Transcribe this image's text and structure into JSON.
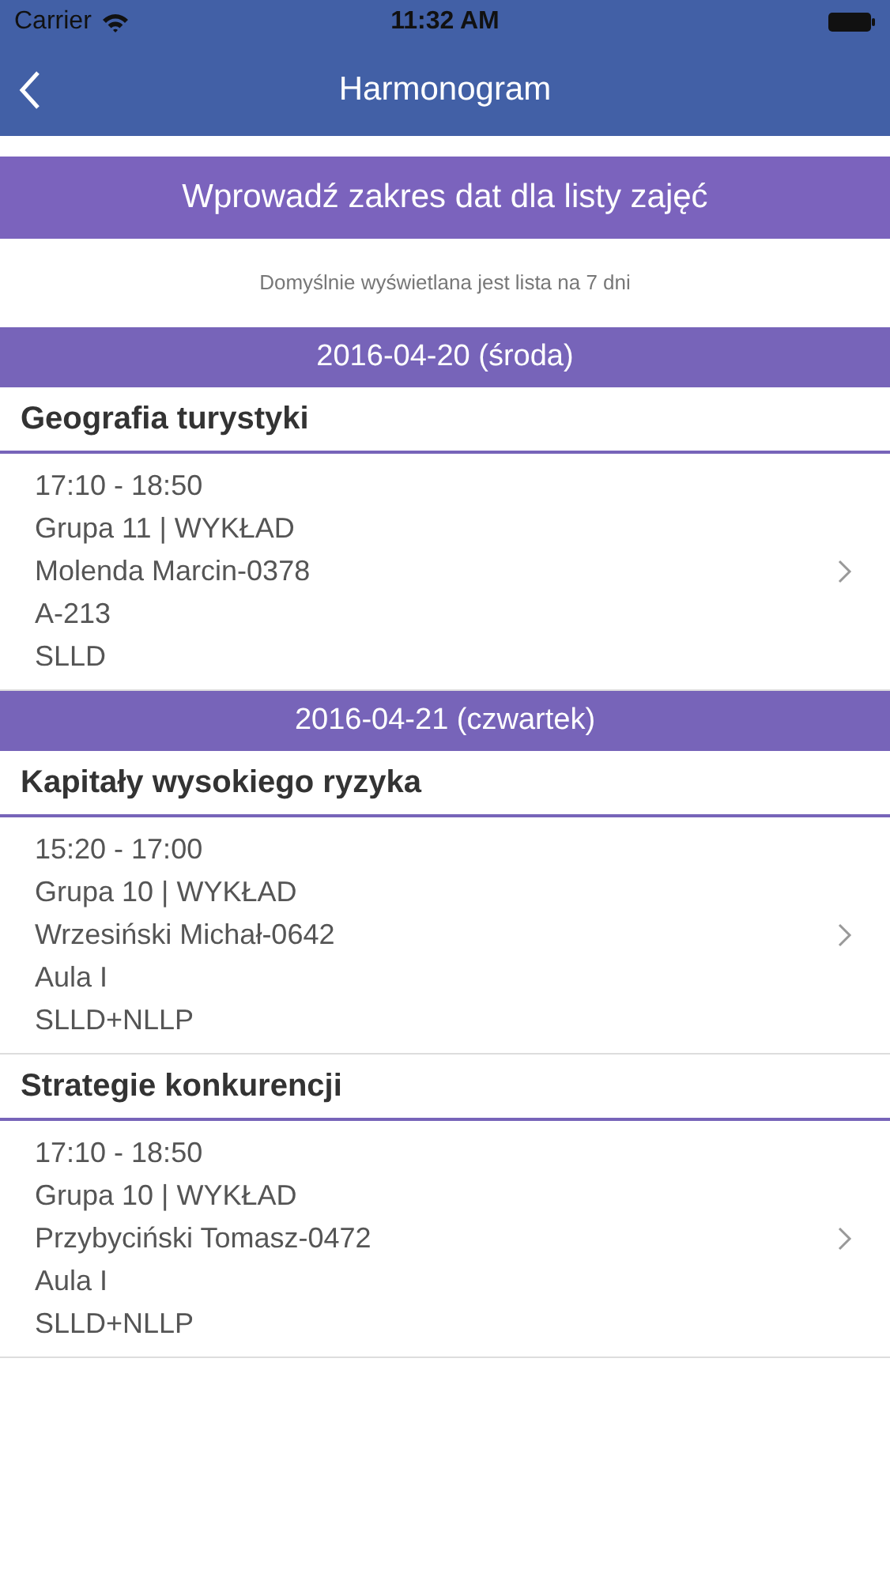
{
  "status_bar": {
    "carrier": "Carrier",
    "time": "11:32 AM"
  },
  "nav": {
    "title": "Harmonogram"
  },
  "date_range_button": "Wprowadź zakres dat dla listy zajęć",
  "note": "Domyślnie wyświetlana jest lista na 7 dni",
  "days": [
    {
      "date": "2016-04-20 (środa)",
      "classes": [
        {
          "title": "Geografia turystyki",
          "lines": [
            "17:10 - 18:50",
            "Grupa 11 | WYKŁAD",
            "Molenda Marcin-0378",
            "A-213",
            "SLLD"
          ]
        }
      ]
    },
    {
      "date": "2016-04-21 (czwartek)",
      "classes": [
        {
          "title": "Kapitały wysokiego ryzyka",
          "lines": [
            "15:20 - 17:00",
            "Grupa 10 | WYKŁAD",
            "Wrzesiński Michał-0642",
            "Aula I",
            "SLLD+NLLP"
          ]
        },
        {
          "title": "Strategie konkurencji",
          "lines": [
            "17:10 - 18:50",
            "Grupa 10 | WYKŁAD",
            "Przybyciński Tomasz-0472",
            "Aula I",
            "SLLD+NLLP"
          ]
        }
      ]
    }
  ]
}
